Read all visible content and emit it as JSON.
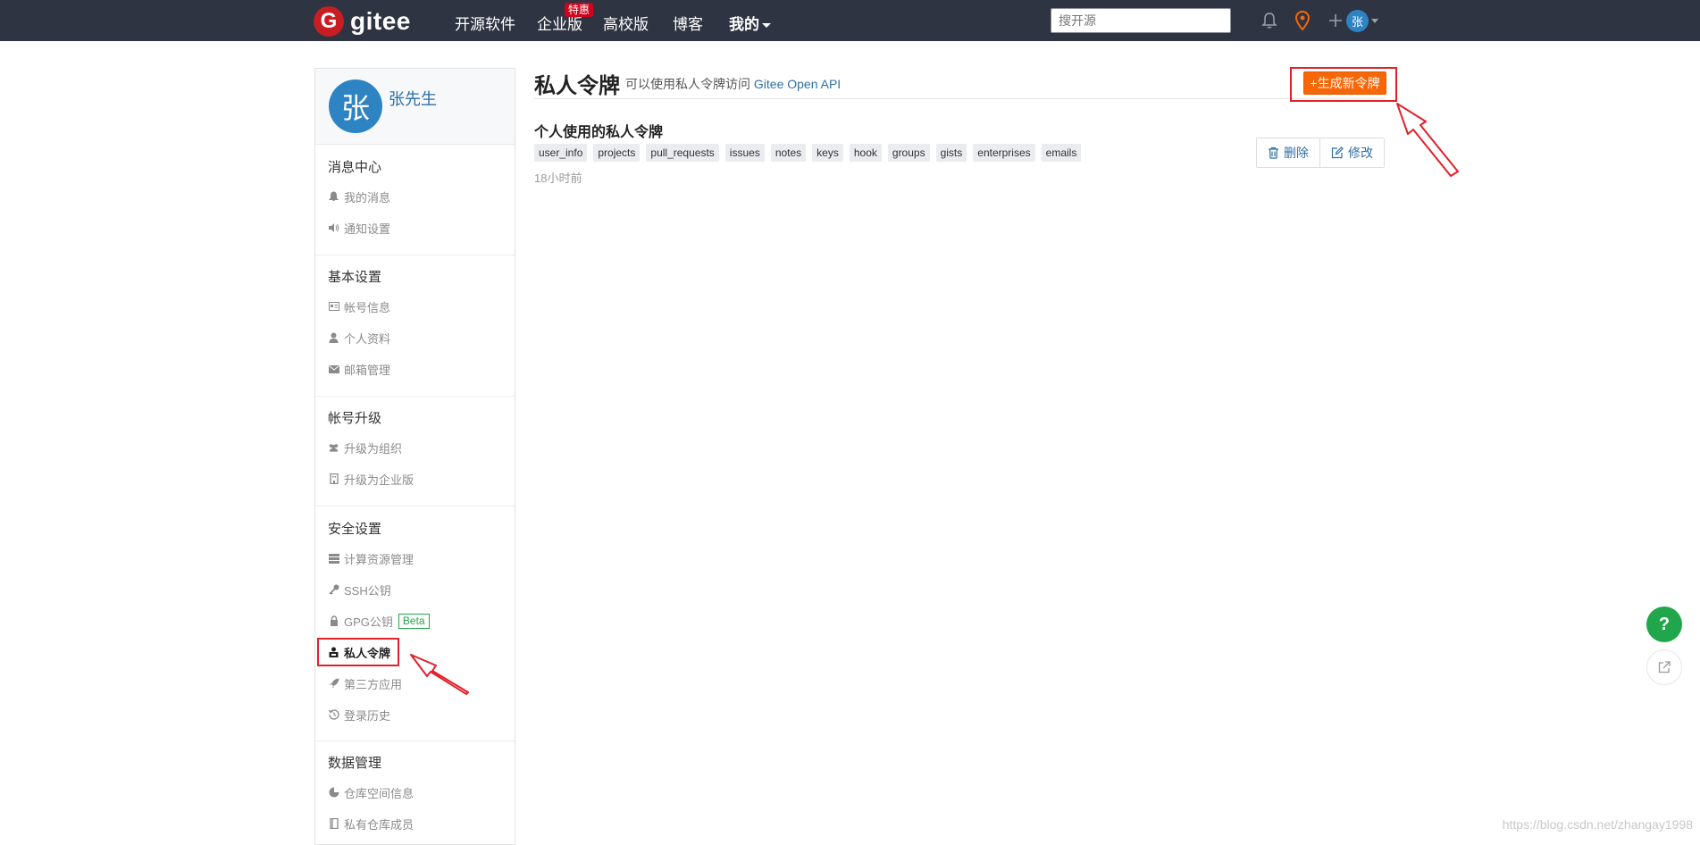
{
  "nav": {
    "logo_text": "gitee",
    "logo_letter": "G",
    "links": [
      "开源软件",
      "企业版",
      "高校版",
      "博客",
      "我的"
    ],
    "enterprise_badge": "特惠",
    "search_placeholder": "搜开源",
    "avatar_letter": "张"
  },
  "sidebar": {
    "avatar_letter": "张",
    "username": "张先生",
    "sections": [
      {
        "title": "消息中心",
        "items": [
          {
            "label": "我的消息",
            "icon": "bell-icon"
          },
          {
            "label": "通知设置",
            "icon": "speaker-icon"
          }
        ]
      },
      {
        "title": "基本设置",
        "items": [
          {
            "label": "帐号信息",
            "icon": "id-card-icon"
          },
          {
            "label": "个人资料",
            "icon": "user-icon"
          },
          {
            "label": "邮箱管理",
            "icon": "mail-icon"
          }
        ]
      },
      {
        "title": "帐号升级",
        "items": [
          {
            "label": "升级为组织",
            "icon": "users-icon"
          },
          {
            "label": "升级为企业版",
            "icon": "building-icon"
          }
        ]
      },
      {
        "title": "安全设置",
        "items": [
          {
            "label": "计算资源管理",
            "icon": "server-icon"
          },
          {
            "label": "SSH公钥",
            "icon": "key-icon"
          },
          {
            "label": "GPG公钥",
            "icon": "lock-icon",
            "badge": "Beta"
          },
          {
            "label": "私人令牌",
            "icon": "token-icon",
            "active": true
          },
          {
            "label": "第三方应用",
            "icon": "rocket-icon"
          },
          {
            "label": "登录历史",
            "icon": "history-icon"
          }
        ]
      },
      {
        "title": "数据管理",
        "items": [
          {
            "label": "仓库空间信息",
            "icon": "pie-icon"
          },
          {
            "label": "私有仓库成员",
            "icon": "book-icon"
          }
        ]
      }
    ]
  },
  "main": {
    "title": "私人令牌",
    "subtitle_prefix": "可以使用私人令牌访问",
    "subtitle_link": "Gitee Open API",
    "generate_button": "+生成新令牌",
    "token": {
      "name": "个人使用的私人令牌",
      "scopes": [
        "user_info",
        "projects",
        "pull_requests",
        "issues",
        "notes",
        "keys",
        "hook",
        "groups",
        "gists",
        "enterprises",
        "emails"
      ],
      "time": "18小时前",
      "delete_label": "删除",
      "edit_label": "修改"
    }
  },
  "floating": {
    "help_label": "?"
  },
  "watermark": "https://blog.csdn.net/zhangay1998",
  "colors": {
    "nav_bg": "#2f3442",
    "accent_orange": "#f76707",
    "brand_red": "#c71d23",
    "highlight_red": "#e0212a",
    "link_blue": "#2e6fa7",
    "help_green": "#21a64b"
  }
}
